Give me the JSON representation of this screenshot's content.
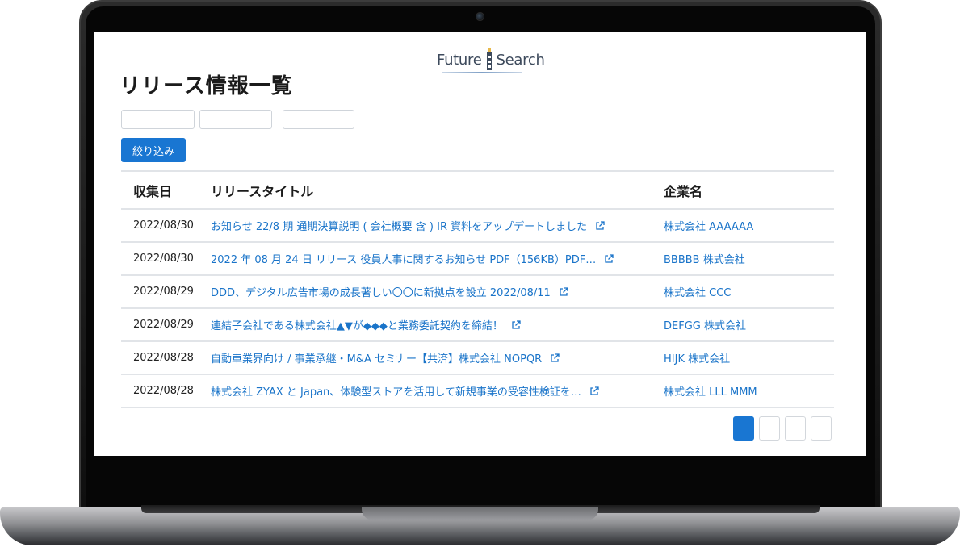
{
  "logo": {
    "left_word": "Future",
    "right_word": "Search"
  },
  "page": {
    "title": "リリース情報一覧"
  },
  "filter": {
    "button_label": "絞り込み"
  },
  "table": {
    "headers": {
      "date": "収集日",
      "title": "リリースタイトル",
      "company": "企業名"
    },
    "rows": [
      {
        "date": "2022/08/30",
        "title": "お知らせ 22/8 期 通期決算説明 ( 会社概要 含 ) IR 資料をアップデートしました",
        "company": "株式会社 AAAAAA"
      },
      {
        "date": "2022/08/30",
        "title": "2022 年 08 月 24 日 リリース 役員人事に関するお知らせ PDF（156KB）PDF…",
        "company": "BBBBB 株式会社"
      },
      {
        "date": "2022/08/29",
        "title": "DDD、デジタル広告市場の成長著しい〇〇に新拠点を設立 2022/08/11",
        "company": "株式会社 CCC"
      },
      {
        "date": "2022/08/29",
        "title": "連結子会社である株式会社▲▼が◆◆◆と業務委託契約を締結！",
        "company": "DEFGG 株式会社"
      },
      {
        "date": "2022/08/28",
        "title": "自動車業界向け / 事業承継・M&A セミナー【共済】株式会社 NOPQR",
        "company": "HIJK 株式会社"
      },
      {
        "date": "2022/08/28",
        "title": "株式会社 ZYAX と Japan、体験型ストアを活用して新規事業の受容性検証を…",
        "company": "株式会社 LLL MMM"
      }
    ]
  },
  "pagination": {
    "page_count": 4,
    "active_page": 1
  },
  "colors": {
    "accent": "#1976d2",
    "link": "#1a74c9"
  },
  "icons": {
    "row_link": "external-link-icon"
  }
}
